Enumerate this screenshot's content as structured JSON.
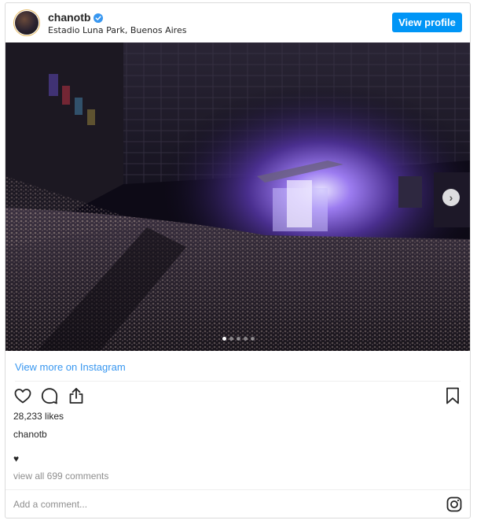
{
  "post": {
    "username": "chanotb",
    "location": "Estadio Luna Park, Buenos Aires",
    "view_profile_label": "View profile",
    "view_more_label": "View more on Instagram",
    "likes": "28,233 likes",
    "caption_username": "chanotb",
    "caption_text": "♥",
    "comments_link": "view all 699 comments",
    "comment_placeholder": "Add a comment...",
    "carousel": {
      "total_slides": 5,
      "active_index": 0
    }
  },
  "colors": {
    "accent": "#0095f6",
    "link": "#3897f0",
    "muted": "#8e8e8e",
    "stage_purple": "#7b55d8"
  },
  "icons": {
    "verified": "verified-badge-icon",
    "like": "heart-outline-icon",
    "comment": "comment-bubble-icon",
    "share": "share-icon",
    "save": "bookmark-icon",
    "next": "chevron-right-icon",
    "brand": "instagram-logo-icon"
  }
}
